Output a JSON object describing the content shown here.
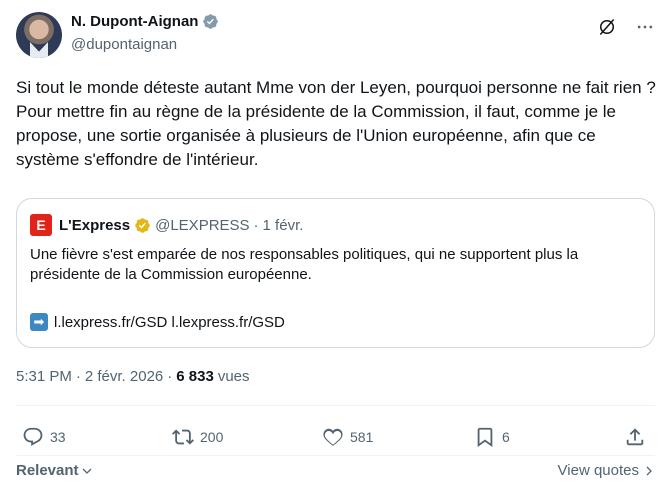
{
  "author": {
    "name": "N. Dupont-Aignan",
    "handle": "@dupontaignan"
  },
  "tweet": {
    "text": "Si tout le monde déteste autant Mme von der Leyen, pourquoi personne ne fait rien ? Pour mettre fin au règne de la présidente de la Commission, il faut, comme je le propose, une sortie organisée à plusieurs de l'Union européenne, afin que ce système s'effondre de l'intérieur."
  },
  "quote": {
    "logo_letter": "E",
    "name": "L'Express",
    "handle": "@LEXPRESS",
    "separator": "·",
    "date": "1 févr.",
    "text": "Une fièvre s'est emparée de nos responsables politiques, qui ne supportent plus la présidente de la Commission européenne.",
    "arrow": "➡",
    "links": "l.lexpress.fr/GSD l.lexpress.fr/GSD"
  },
  "meta": {
    "time": "5:31 PM",
    "separator1": "·",
    "date": "2 févr. 2026",
    "separator2": "·",
    "views_count": "6 833",
    "views_label": "vues"
  },
  "actions": {
    "replies": "33",
    "retweets": "200",
    "likes": "581",
    "bookmarks": "6"
  },
  "footer": {
    "relevant": "Relevant",
    "view_quotes": "View quotes"
  },
  "colors": {
    "text": "#0f1419",
    "muted": "#536471",
    "verified_blue": "#1d9bf0",
    "verified_gold": "#e2b719",
    "express_red": "#e2231a",
    "border": "#cfd9de"
  },
  "icons": {
    "verified": "verified-badge-icon",
    "grok": "grok-icon",
    "more": "more-icon",
    "reply": "reply-icon",
    "retweet": "retweet-icon",
    "like": "heart-icon",
    "bookmark": "bookmark-icon",
    "share": "share-icon"
  }
}
